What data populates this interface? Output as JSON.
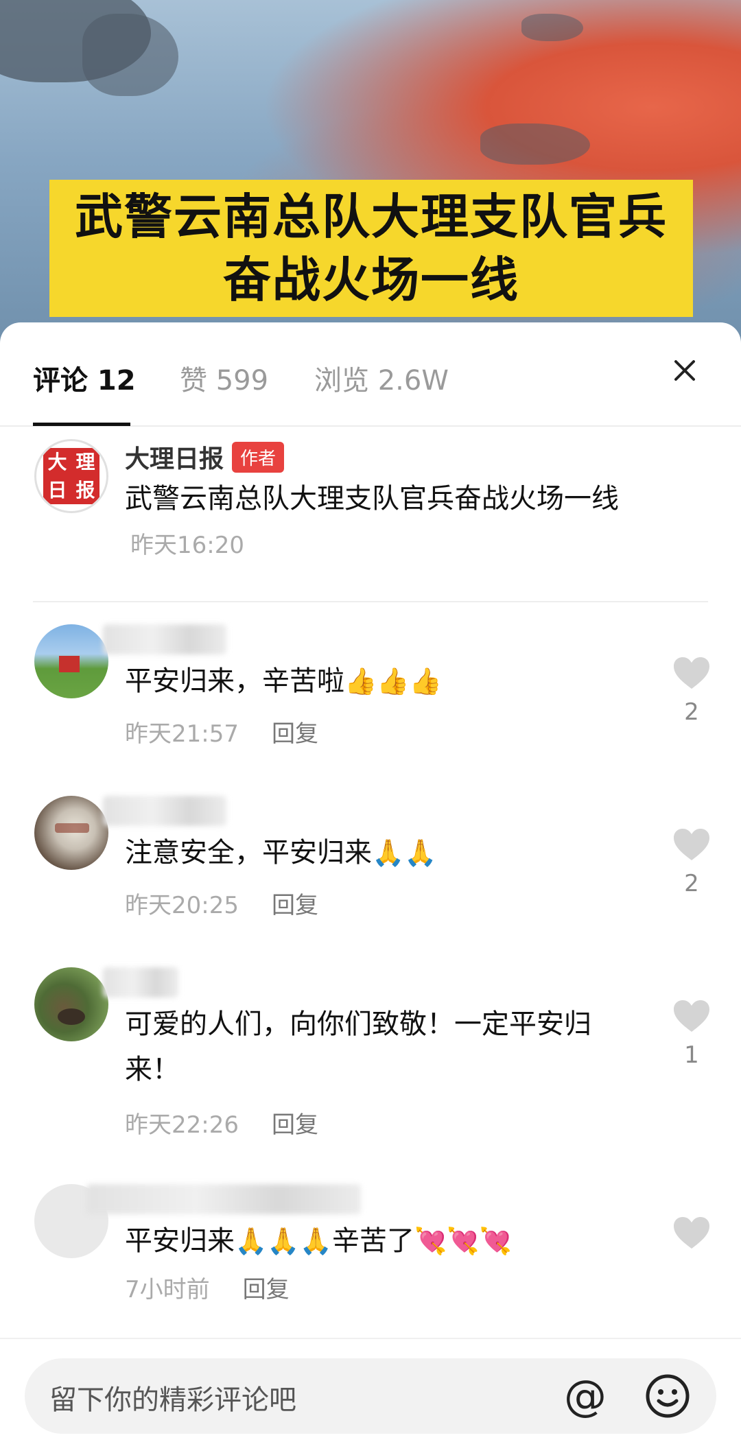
{
  "video": {
    "caption_line1": "武警云南总队大理支队官兵",
    "caption_line2": "奋战火场一线"
  },
  "tabs": [
    {
      "label": "评论 12",
      "active": true
    },
    {
      "label": "赞 599",
      "active": false
    },
    {
      "label": "浏览 2.6W",
      "active": false
    }
  ],
  "author_post": {
    "name": "大理日报",
    "badge": "作者",
    "avatar_text": [
      "大",
      "理",
      "日",
      "报"
    ],
    "text": "武警云南总队大理支队官兵奋战火场一线",
    "time": "昨天16:20"
  },
  "comments": [
    {
      "text": "平安归来，辛苦啦",
      "emoji": "👍👍👍",
      "time": "昨天21:57",
      "reply": "回复",
      "likes": "2"
    },
    {
      "text": "注意安全，平安归来",
      "emoji": "🙏🙏",
      "time": "昨天20:25",
      "reply": "回复",
      "likes": "2"
    },
    {
      "text": "可爱的人们，向你们致敬！一定平安归来！",
      "emoji": "",
      "time": "昨天22:26",
      "reply": "回复",
      "likes": "1"
    },
    {
      "text": "平安归来",
      "emoji": "🙏🙏🙏",
      "text2": "辛苦了",
      "emoji2": "💘💘💘",
      "time": "7小时前",
      "reply": "回复",
      "likes": ""
    }
  ],
  "input": {
    "placeholder": "留下你的精彩评论吧",
    "at_icon": "@",
    "emoji_icon": "smiley-icon"
  },
  "colors": {
    "caption_bg": "#f6d72c",
    "author_badge": "#e8423f",
    "avatar_seal": "#d32c2c"
  }
}
